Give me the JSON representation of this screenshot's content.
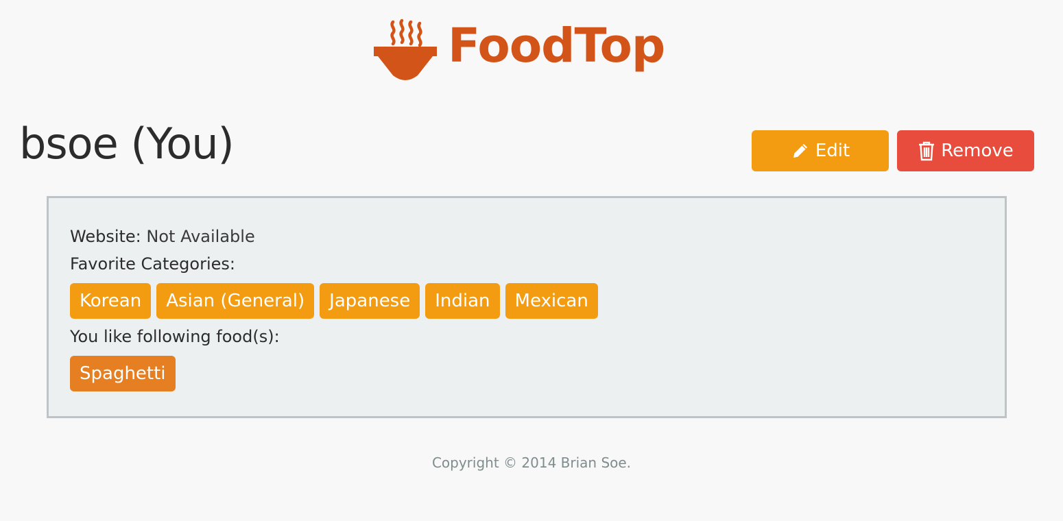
{
  "brand": {
    "name": "FoodTop",
    "color": "#d35418"
  },
  "profile": {
    "title": "bsoe (You)",
    "website_label": "Website:",
    "website_value": "Not Available",
    "categories_label": "Favorite Categories:",
    "categories": [
      "Korean",
      "Asian (General)",
      "Japanese",
      "Indian",
      "Mexican"
    ],
    "foods_label": "You like following food(s):",
    "foods": [
      "Spaghetti"
    ]
  },
  "actions": {
    "edit_label": "Edit",
    "edit_icon": "pencil-icon",
    "edit_color": "#f39c12",
    "remove_label": "Remove",
    "remove_icon": "trash-icon",
    "remove_color": "#e74c3c"
  },
  "colors": {
    "category_tag": "#f39c12",
    "food_tag": "#e67e22",
    "well_background": "#ecf0f1",
    "page_background": "#f8f8f8"
  },
  "footer": {
    "copyright": "Copyright © 2014 Brian Soe."
  }
}
